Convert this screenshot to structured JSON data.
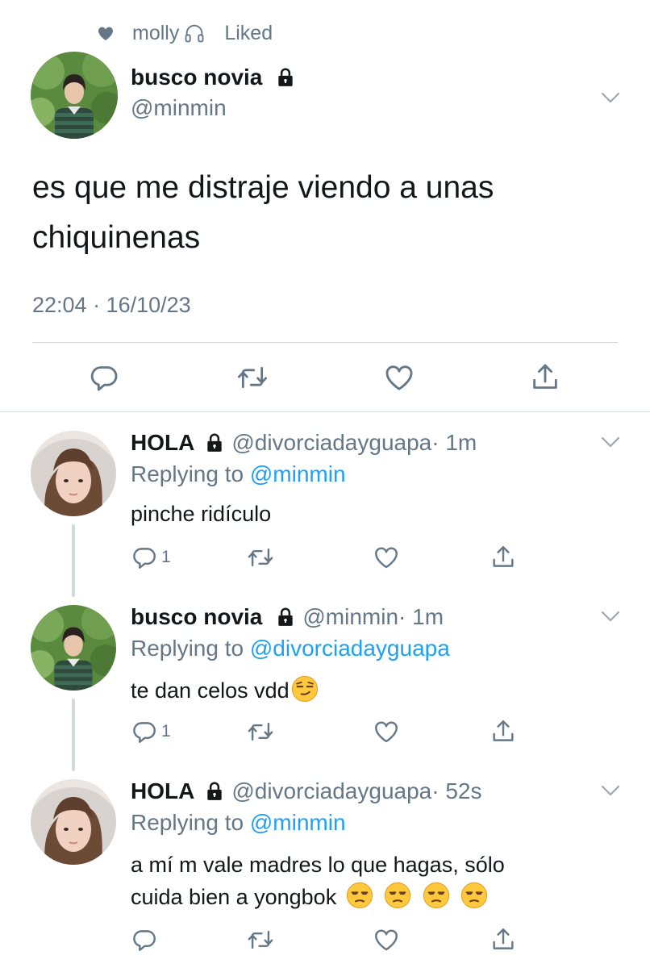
{
  "liked_by": {
    "name": "molly",
    "suffix": "Liked"
  },
  "main_tweet": {
    "display_name": "busco novia",
    "handle": "@minmin",
    "text": "es que me distraje viendo a unas chiquinenas",
    "timestamp": "22:04 · 16/10/23"
  },
  "replies": [
    {
      "display_name": "HOLA",
      "handle": "@divorciadayguapa",
      "time": "· 1m",
      "replying_prefix": "Replying to",
      "replying_to": "@minmin",
      "text": "pinche ridículo",
      "reply_count": "1"
    },
    {
      "display_name": "busco novia",
      "handle": "@minmin",
      "time": "· 1m",
      "replying_prefix": "Replying to",
      "replying_to": "@divorciadayguapa",
      "text": "te dan celos vdd",
      "reply_count": "1"
    },
    {
      "display_name": "HOLA",
      "handle": "@divorciadayguapa",
      "time": "· 52s",
      "replying_prefix": "Replying to",
      "replying_to": "@minmin",
      "text_line1": "a mí m vale madres lo que hagas, sólo",
      "text_line2": "cuida bien a yongbok",
      "reply_count": ""
    }
  ],
  "icons": [
    "heart-icon",
    "headphones-icon",
    "lock-icon",
    "chevron-down-icon",
    "reply-icon",
    "retweet-icon",
    "like-icon",
    "share-icon",
    "smirk-emoji",
    "unamused-emoji"
  ],
  "colors": {
    "accent": "#1da1f2",
    "secondary_text": "#657786",
    "text": "#14171a"
  }
}
